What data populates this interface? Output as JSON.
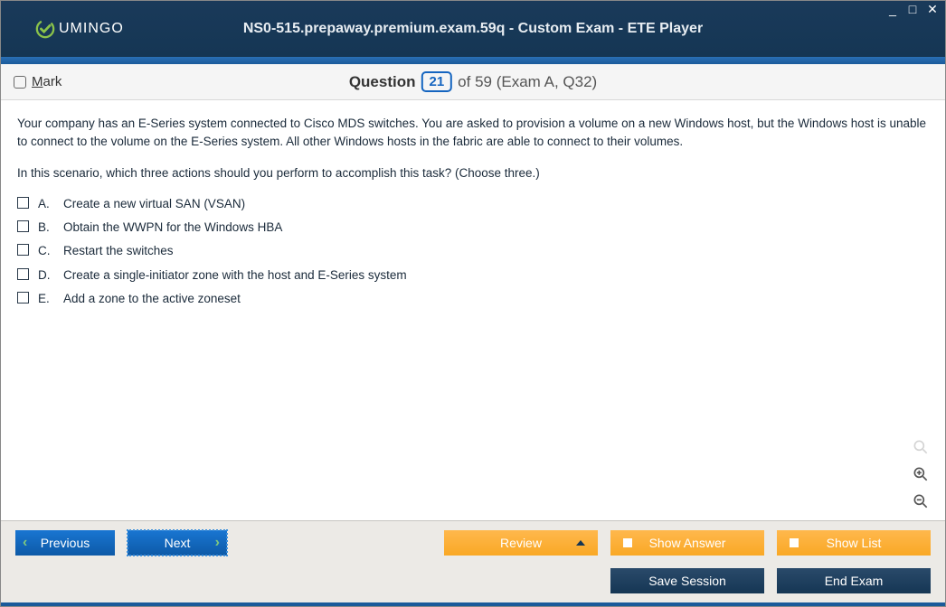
{
  "window": {
    "title": "NS0-515.prepaway.premium.exam.59q - Custom Exam - ETE Player",
    "logo_text": "UMINGO"
  },
  "questionbar": {
    "mark_label": "Mark",
    "question_word": "Question",
    "current": "21",
    "total_suffix": "of 59 (Exam A, Q32)"
  },
  "question": {
    "para1": "Your company has an E-Series system connected to Cisco MDS switches. You are asked to provision a volume on a new Windows host, but the Windows host is unable to connect to the volume on the E-Series system. All other Windows hosts in the fabric are able to connect to their volumes.",
    "para2": "In this scenario, which three actions should you perform to accomplish this task? (Choose three.)",
    "options": [
      {
        "letter": "A.",
        "text": "Create a new virtual SAN (VSAN)"
      },
      {
        "letter": "B.",
        "text": "Obtain the WWPN for the Windows HBA"
      },
      {
        "letter": "C.",
        "text": "Restart the switches"
      },
      {
        "letter": "D.",
        "text": "Create a single-initiator zone with the host and E-Series system"
      },
      {
        "letter": "E.",
        "text": "Add a zone to the active zoneset"
      }
    ]
  },
  "buttons": {
    "previous": "Previous",
    "next": "Next",
    "review": "Review",
    "show_answer": "Show Answer",
    "show_list": "Show List",
    "save_session": "Save Session",
    "end_exam": "End Exam"
  }
}
